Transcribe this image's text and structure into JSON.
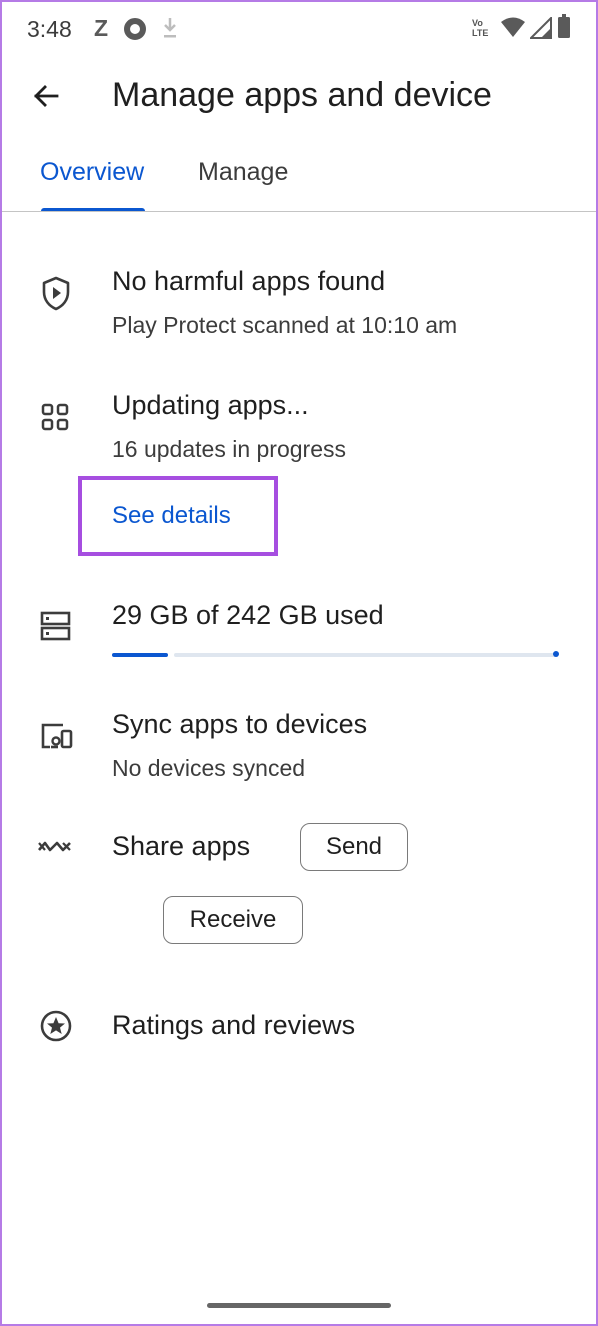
{
  "status_bar": {
    "time": "3:48",
    "carrier_glyph": "Z",
    "volte_label_top": "Vo",
    "volte_label_bottom": "LTE",
    "icons": [
      "z-notification-icon",
      "ring-notification-icon",
      "download-icon",
      "volte-icon",
      "wifi-icon",
      "signal-icon",
      "battery-icon"
    ]
  },
  "app_bar": {
    "back_icon": "back-arrow-icon",
    "title": "Manage apps and device"
  },
  "tabs": [
    {
      "label": "Overview",
      "selected": true
    },
    {
      "label": "Manage",
      "selected": false
    }
  ],
  "rows": {
    "protect": {
      "icon": "shield-play-icon",
      "title": "No harmful apps found",
      "subtitle": "Play Protect scanned at 10:10 am"
    },
    "updates": {
      "icon": "apps-grid-icon",
      "title": "Updating apps...",
      "subtitle": "16 updates in progress",
      "link": "See details"
    },
    "storage": {
      "icon": "storage-icon",
      "title": "29 GB of 242 GB used",
      "used_gb": 29,
      "total_gb": 242
    },
    "sync": {
      "icon": "devices-icon",
      "title": "Sync apps to devices",
      "subtitle": "No devices synced"
    },
    "share": {
      "icon": "share-apps-icon",
      "title": "Share apps",
      "send_label": "Send",
      "receive_label": "Receive"
    },
    "ratings": {
      "icon": "star-circle-icon",
      "title": "Ratings and reviews"
    }
  },
  "colors": {
    "accent": "#0b57d0",
    "highlight_box": "#a64ee0",
    "frame": "#b57be6"
  }
}
